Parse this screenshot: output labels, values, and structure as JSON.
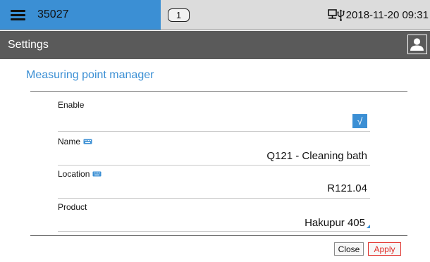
{
  "topbar": {
    "device_id": "35027",
    "badge_count": "1",
    "datetime": "2018-11-20 09:31",
    "icons": [
      "menu-icon",
      "network-icon",
      "usb-icon"
    ]
  },
  "header": {
    "title": "Settings",
    "icons": [
      "user-icon"
    ]
  },
  "section": {
    "title": "Measuring point manager"
  },
  "fields": {
    "enable": {
      "label": "Enable",
      "checked": true,
      "check_glyph": "√"
    },
    "name": {
      "label": "Name",
      "value": "Q121 - Cleaning bath",
      "icon": "keyboard-icon"
    },
    "location": {
      "label": "Location",
      "value": "R121.04",
      "icon": "keyboard-icon"
    },
    "product": {
      "label": "Product",
      "value": "Hakupur 405",
      "icon": "dropdown-indicator-icon"
    }
  },
  "buttons": {
    "close": "Close",
    "apply": "Apply"
  },
  "colors": {
    "accent": "#3b8fd4",
    "header_bg": "#5a5a5a",
    "apply": "#e0302b"
  }
}
